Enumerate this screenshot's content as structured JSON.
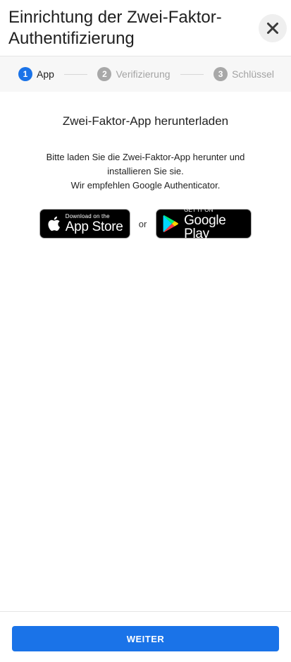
{
  "header": {
    "title": "Einrichtung der Zwei-Faktor-Authentifizierung",
    "close_icon": "close-icon"
  },
  "stepper": {
    "steps": [
      {
        "number": "1",
        "label": "App",
        "state": "active"
      },
      {
        "number": "2",
        "label": "Verifizierung",
        "state": "inactive"
      },
      {
        "number": "3",
        "label": "Schlüssel",
        "state": "inactive"
      }
    ],
    "active_color": "#1a73e8",
    "inactive_color": "#a8a8a8"
  },
  "main": {
    "heading": "Zwei-Faktor-App herunterladen",
    "description_line1": "Bitte laden Sie die Zwei-Faktor-App herunter und",
    "description_line2": "installieren Sie sie.",
    "description_line3": "Wir empfehlen Google Authenticator.",
    "separator": "or",
    "app_store": {
      "small": "Download on the",
      "big": "App Store",
      "icon": "apple-icon"
    },
    "google_play": {
      "small": "GET IT ON",
      "big": "Google Play",
      "icon": "google-play-icon"
    }
  },
  "footer": {
    "next_label": "WEITER",
    "button_color": "#1a73e8"
  }
}
